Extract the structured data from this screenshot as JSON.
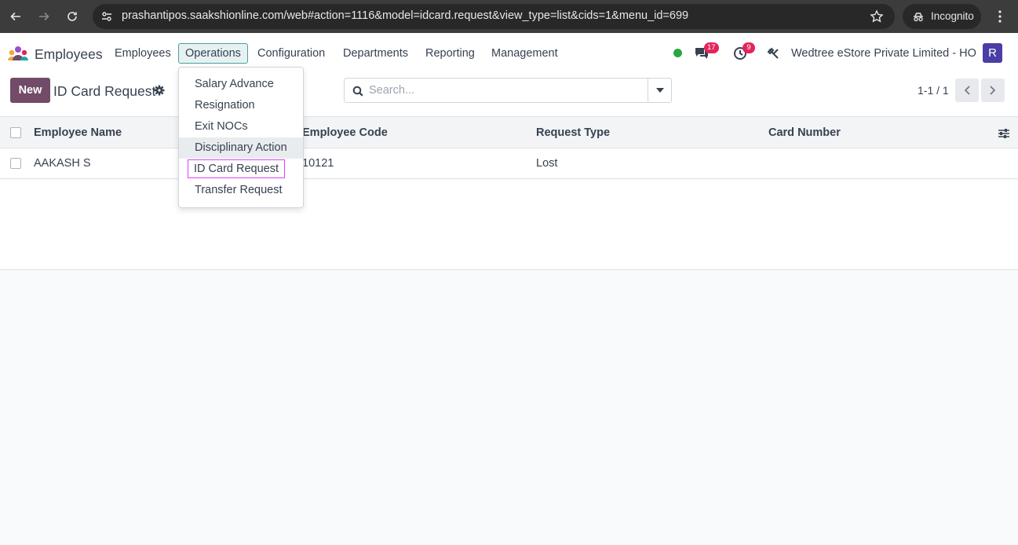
{
  "browser": {
    "url": "prashantipos.saakshionline.com/web#action=1116&model=idcard.request&view_type=list&cids=1&menu_id=699",
    "incognito_label": "Incognito"
  },
  "nav": {
    "app_name": "Employees",
    "menu": [
      "Employees",
      "Operations",
      "Configuration",
      "Departments",
      "Reporting",
      "Management"
    ],
    "messages_badge": "17",
    "activities_badge": "9",
    "company": "Wedtree eStore Private Limited - HO",
    "avatar_letter": "R"
  },
  "control": {
    "new_label": "New",
    "title": "ID Card Request",
    "search_placeholder": "Search...",
    "pager": "1-1 / 1"
  },
  "table": {
    "headers": [
      "Employee Name",
      "Employee Code",
      "Request Type",
      "Card Number"
    ],
    "rows": [
      [
        "AAKASH S",
        "10121",
        "Lost",
        ""
      ]
    ]
  },
  "dropdown": {
    "items": [
      "Salary Advance",
      "Resignation",
      "Exit NOCs",
      "Disciplinary Action",
      "ID Card Request",
      "Transfer Request"
    ]
  },
  "colors": {
    "brand": "#714b67",
    "avatar": "#4a3ea5",
    "badge": "#e3245b",
    "online": "#28a745",
    "highlight_outline": "#e040fb"
  }
}
